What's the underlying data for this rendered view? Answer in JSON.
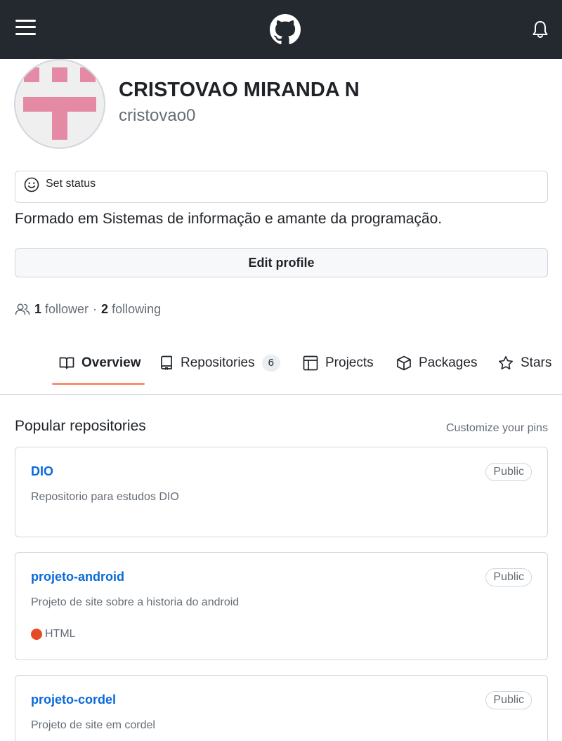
{
  "header": {
    "menu_icon": "hamburger-icon",
    "logo_icon": "github-logo-icon",
    "notification_icon": "bell-icon"
  },
  "profile": {
    "full_name": "CRISTOVAO MIRANDA N",
    "username": "cristovao0",
    "avatar_color": "#e58aa4",
    "status_label": "Set status",
    "bio": "Formado em Sistemas de informação e amante da programação.",
    "edit_label": "Edit profile",
    "followers_count": "1",
    "followers_label": "follower",
    "separator": "·",
    "following_count": "2",
    "following_label": "following"
  },
  "tabs": [
    {
      "label": "Overview",
      "icon": "book-icon",
      "active": true
    },
    {
      "label": "Repositories",
      "icon": "repo-icon",
      "count": "6"
    },
    {
      "label": "Projects",
      "icon": "table-icon"
    },
    {
      "label": "Packages",
      "icon": "package-icon"
    },
    {
      "label": "Stars",
      "icon": "star-icon"
    }
  ],
  "popular": {
    "title": "Popular repositories",
    "customize_label": "Customize your pins",
    "repos": [
      {
        "name": "DIO",
        "visibility": "Public",
        "description": "Repositorio para estudos DIO"
      },
      {
        "name": "projeto-android",
        "visibility": "Public",
        "description": "Projeto de site sobre a historia do android",
        "language": "HTML",
        "language_color": "#e34c26"
      },
      {
        "name": "projeto-cordel",
        "visibility": "Public",
        "description": "Projeto de site em cordel"
      }
    ]
  },
  "colors": {
    "header_bg": "#24292f",
    "link": "#0969da",
    "tab_underline": "#fd8c73",
    "muted": "#656d76"
  }
}
